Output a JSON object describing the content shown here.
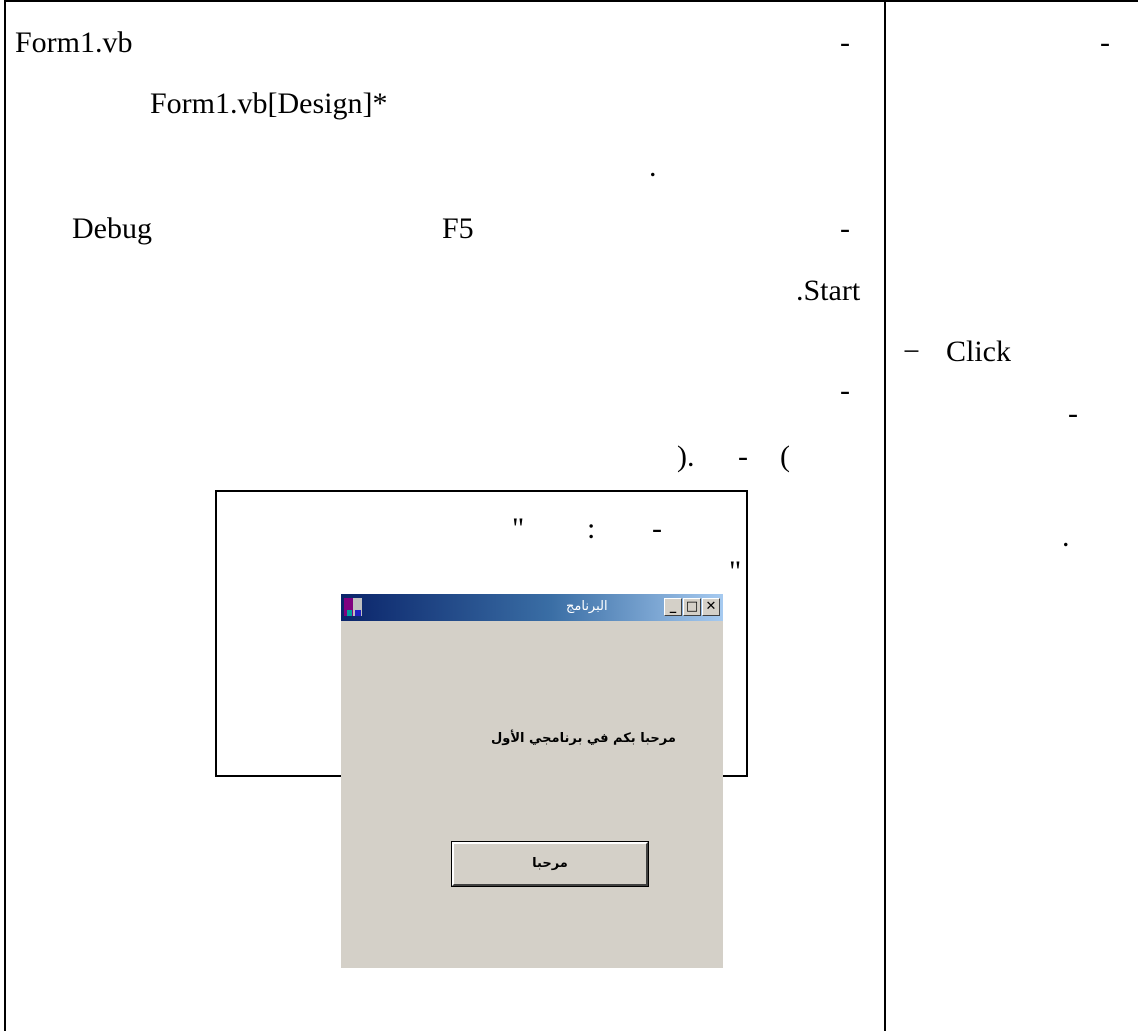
{
  "left_column": {
    "line1_file": "Form1.vb",
    "line1_dash": "-",
    "line2_design_tab": "Form1.vb[Design]*",
    "line3_period": ".",
    "line4_menu": "Debug",
    "line4_key": "F5",
    "line4_dash": "-",
    "line5_start": ".Start",
    "line6_dash": "-",
    "line7_paren_open": "(",
    "line7_dash": "-",
    "line7_paren_close": ").",
    "caption_dash": "-",
    "caption_colon": ":",
    "caption_quote_open": "\"",
    "caption_quote_close": "\""
  },
  "right_column": {
    "top_dash": "-",
    "click_dash": "−",
    "click_label": "Click",
    "dash2": "-",
    "period": "."
  },
  "app_window": {
    "title": "البرنامج",
    "minimize_glyph": "_",
    "maximize_glyph": "□",
    "close_glyph": "✕",
    "label_text": "مرحبا بكم في برنامجي الأول",
    "button_text": "مرحبا",
    "colors": {
      "face": "#d4d0c8",
      "title_start": "#0a246a",
      "title_end": "#a6caf0"
    },
    "icon_name": "app-icon"
  }
}
